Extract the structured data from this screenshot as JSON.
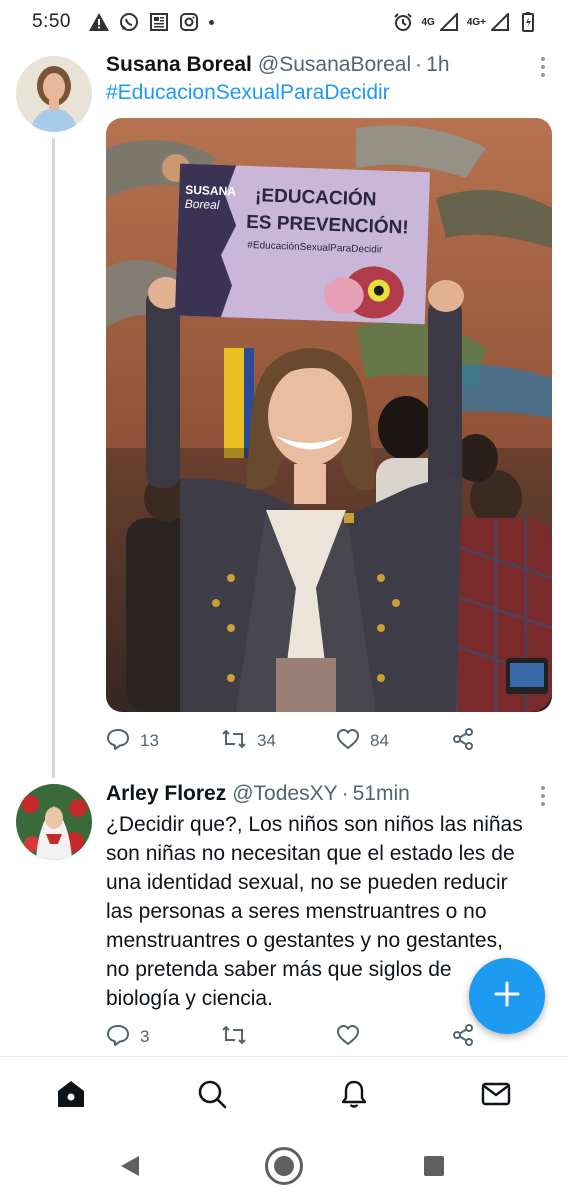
{
  "status_bar": {
    "time": "5:50",
    "left_icons": [
      "warning-icon",
      "whatsapp-icon",
      "news-icon",
      "instagram-icon",
      "dot-icon"
    ],
    "right_icons": [
      "alarm-icon",
      "4g-signal-icon",
      "4g-plus-signal-icon",
      "battery-icon"
    ],
    "net_label_1": "4G",
    "net_label_2": "4G+"
  },
  "tweet1": {
    "name": "Susana Boreal",
    "handle": "@SusanaBoreal",
    "separator": "·",
    "time": "1h",
    "hashtag": "#EducacionSexualParaDecidir",
    "photo": {
      "sign_brand_line1": "SUSANA",
      "sign_brand_line2": "Boreal",
      "sign_title_line1": "¡EDUCACIÓN",
      "sign_title_line2": "ES PREVENCIÓN!",
      "sign_hashtag": "#EducaciónSexualParaDecidir"
    },
    "replies": "13",
    "retweets": "34",
    "likes": "84"
  },
  "tweet2": {
    "name": "Arley Florez",
    "handle": "@TodesXY",
    "separator": "·",
    "time": "51min",
    "text_lines": [
      "¿Decidir que?, Los niños son niños las niñas",
      "son niñas no necesitan que el estado les de",
      "una identidad sexual, no se pueden reducir",
      "las personas a seres menstruantres o no",
      "menstruantres o gestantes y no gestantes,",
      "no pretenda saber más que siglos de",
      "biología y ciencia."
    ],
    "replies": "3",
    "retweets": "",
    "likes": ""
  },
  "fab": {
    "icon": "plus-icon"
  },
  "tabbar": {
    "tabs": [
      "home-icon",
      "search-icon",
      "notifications-icon",
      "messages-icon"
    ]
  },
  "navbar": {
    "buttons": [
      "back-icon",
      "home-circle-icon",
      "recents-icon"
    ]
  },
  "colors": {
    "accent": "#1d9bf0",
    "text": "#0f1419",
    "muted": "#536471"
  }
}
